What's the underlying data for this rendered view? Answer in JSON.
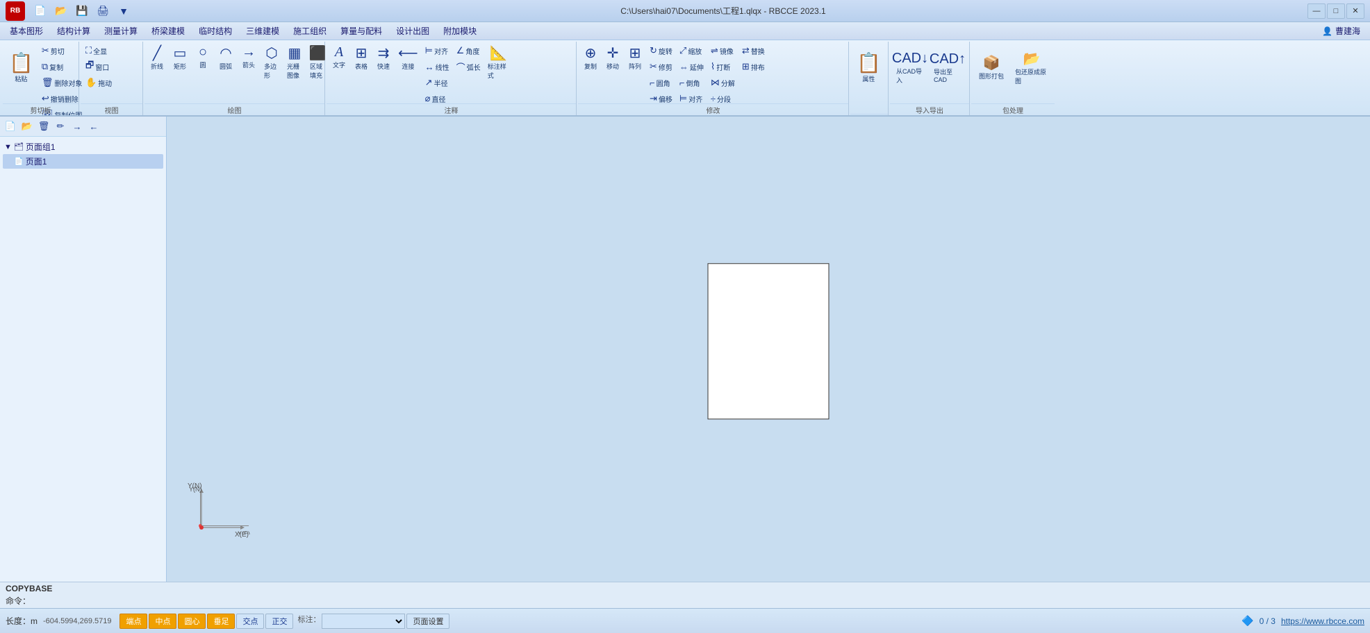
{
  "titlebar": {
    "title": "C:\\Users\\hai07\\Documents\\工程1.qlqx - RBCCE 2023.1",
    "app_logo": "RB",
    "minimize_label": "—",
    "maximize_label": "□",
    "close_label": "✕"
  },
  "menubar": {
    "items": [
      {
        "label": "基本图形"
      },
      {
        "label": "结构计算"
      },
      {
        "label": "测量计算"
      },
      {
        "label": "桥梁建模"
      },
      {
        "label": "临时结构"
      },
      {
        "label": "三维建模"
      },
      {
        "label": "施工组织"
      },
      {
        "label": "算量与配料"
      },
      {
        "label": "设计出图"
      },
      {
        "label": "附加模块"
      }
    ],
    "user": "曹建海"
  },
  "toolbar": {
    "clipboard": {
      "label": "剪切板",
      "paste": "粘贴",
      "cut": "剪切",
      "copy": "复制",
      "delete_obj": "删除对象",
      "undo_delete": "撤销删除",
      "copy_pos": "复制位图"
    },
    "view": {
      "label": "视图",
      "fullscreen": "全显",
      "window": "窗口",
      "drag": "拖动"
    },
    "draw": {
      "label": "绘图",
      "polyline": "折线",
      "rect": "矩形",
      "circle": "圆",
      "arc": "圆弧",
      "arrow": "箭头",
      "polygon": "多边形",
      "hatch": "光栅图像",
      "fill": "区域填充"
    },
    "text": {
      "label": "注释",
      "text": "文字",
      "table": "表格",
      "fast": "快速",
      "connect": "连接",
      "align": "对齐",
      "linear": "线性",
      "halfradius": "半径",
      "diameter": "直径",
      "angle": "角度",
      "arclength": "弧长",
      "mark_style": "标注样式"
    },
    "modify": {
      "label": "修改",
      "copy2": "复制",
      "move": "移动",
      "array": "阵列",
      "rotate": "旋转",
      "trim": "修剪",
      "scale": "缩放",
      "extend": "延伸",
      "mirror": "镜像",
      "break": "打断",
      "fillet": "圆角",
      "chamfer": "倒角",
      "offset": "偏移",
      "align2": "对齐",
      "explode": "分解",
      "divide": "分段",
      "replace": "替换",
      "arrange": "排布"
    },
    "property": {
      "label": "",
      "props": "属性"
    },
    "importexport": {
      "label": "导入导出",
      "from_cad": "从CAD导入",
      "to_cad": "导出至CAD"
    },
    "packaging": {
      "label": "包处理",
      "pack": "图形打包",
      "restore": "包还原成原图"
    }
  },
  "leftpanel": {
    "toolbar": {
      "new": "新建",
      "open": "打开",
      "delete": "删除",
      "rename": "重命名",
      "indent": "缩进",
      "outdent": "取消缩进"
    },
    "tree": {
      "root": "页面组1",
      "pages": [
        {
          "label": "页面1",
          "selected": true
        }
      ]
    }
  },
  "canvas": {
    "copybase_cmd": "COPYBASE",
    "cmd_prompt": "命令："
  },
  "statusbar": {
    "unit": "长度：m",
    "coordinates": "-604.5994,269.5719",
    "snap_buttons": [
      {
        "label": "端点",
        "active": true
      },
      {
        "label": "中点",
        "active": true
      },
      {
        "label": "圆心",
        "active": true
      },
      {
        "label": "垂足",
        "active": true
      },
      {
        "label": "交点",
        "active": false
      },
      {
        "label": "正交",
        "active": false
      }
    ],
    "annotation_label": "标注：",
    "page_settings": "页面设置",
    "signal": "🔷 0 / 3",
    "website": "https://www.rbcce.com"
  },
  "axis": {
    "y_label": "Y(N)",
    "x_label": "X(E)"
  }
}
